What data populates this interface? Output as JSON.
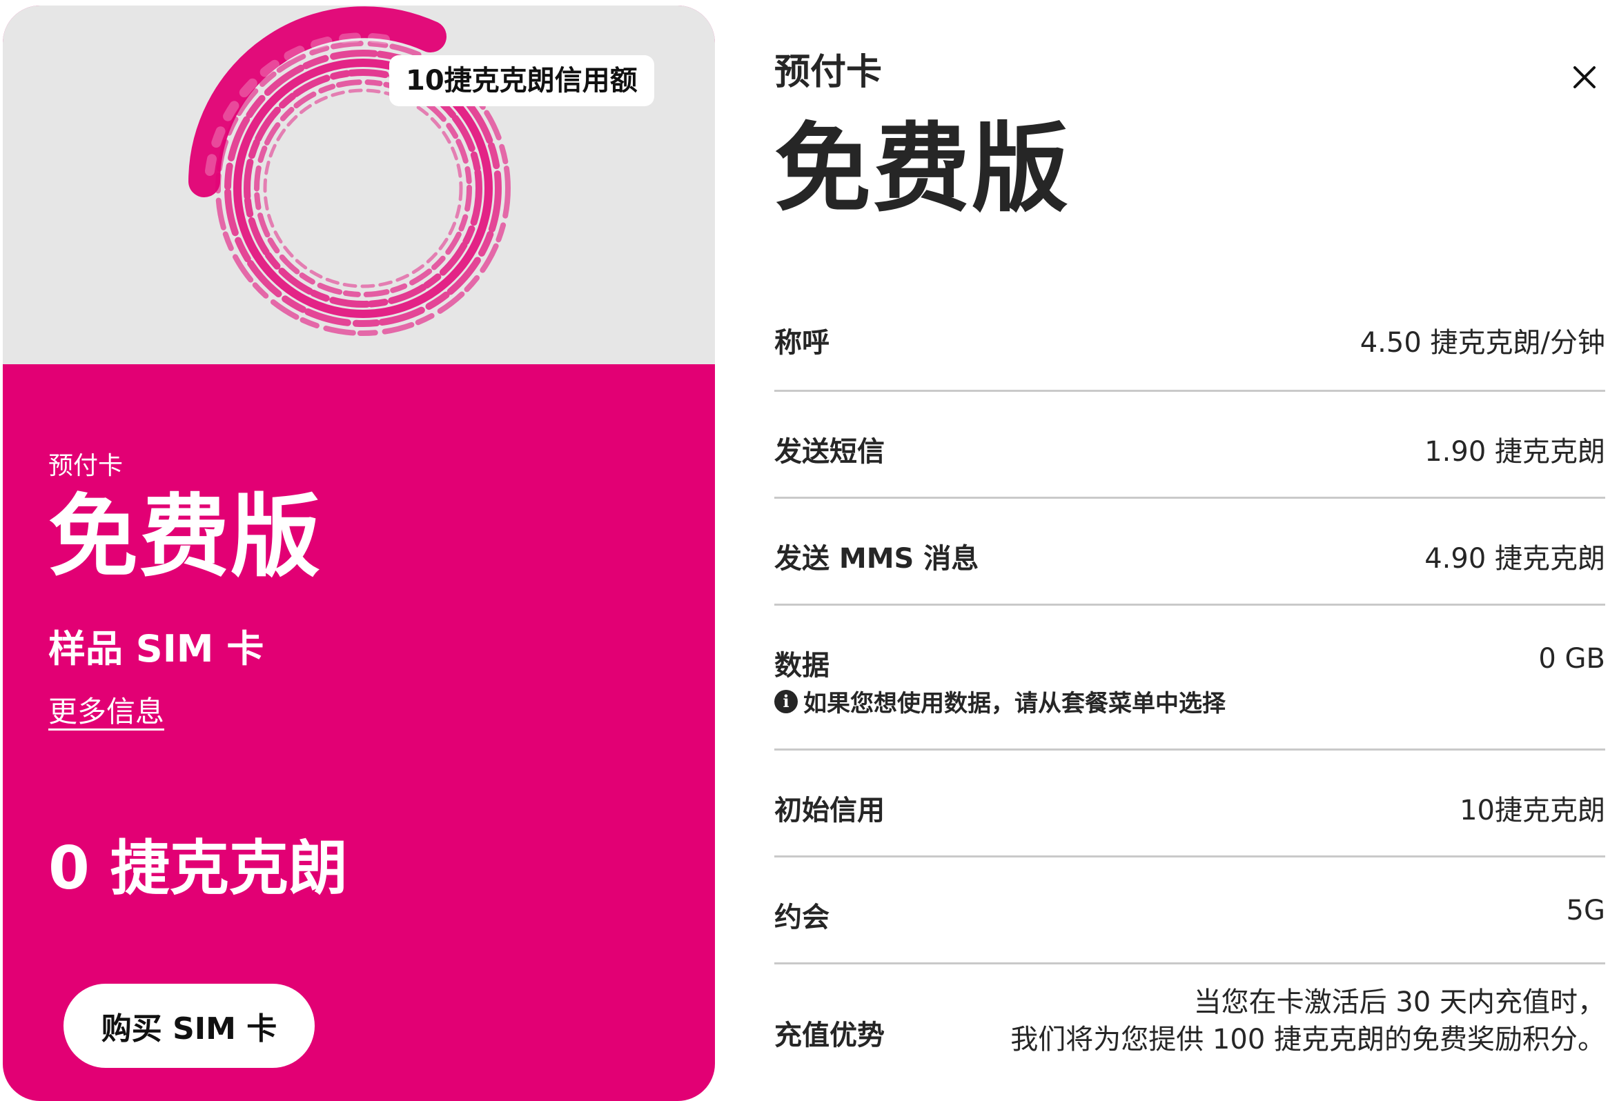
{
  "card": {
    "badge": "10捷克克朗信用额",
    "eyebrow": "预付卡",
    "title": "免费版",
    "subtitle": "样品 SIM 卡",
    "more_info": "更多信息",
    "price": "0 捷克克朗",
    "buy_button": "购买 SIM 卡",
    "colors": {
      "brand": "#e20074",
      "hero_bg": "#e6e6e6"
    }
  },
  "panel": {
    "eyebrow": "预付卡",
    "title": "免费版",
    "close_icon": "close-icon",
    "rows": [
      {
        "label": "称呼",
        "value": "4.50 捷克克朗/分钟"
      },
      {
        "label": "发送短信",
        "value": "1.90 捷克克朗"
      },
      {
        "label": "发送 MMS 消息",
        "value": "4.90 捷克克朗"
      },
      {
        "label": "数据",
        "value": "0 GB",
        "note": "如果您想使用数据，请从套餐菜单中选择",
        "note_icon": "info-icon"
      },
      {
        "label": "初始信用",
        "value": "10捷克克朗"
      },
      {
        "label": "约会",
        "value": "5G"
      },
      {
        "label": "充值优势",
        "value_line1": "当您在卡激活后 30 天内充值时，",
        "value_line2": "我们将为您提供 100 捷克克朗的免费奖励积分。"
      }
    ]
  }
}
